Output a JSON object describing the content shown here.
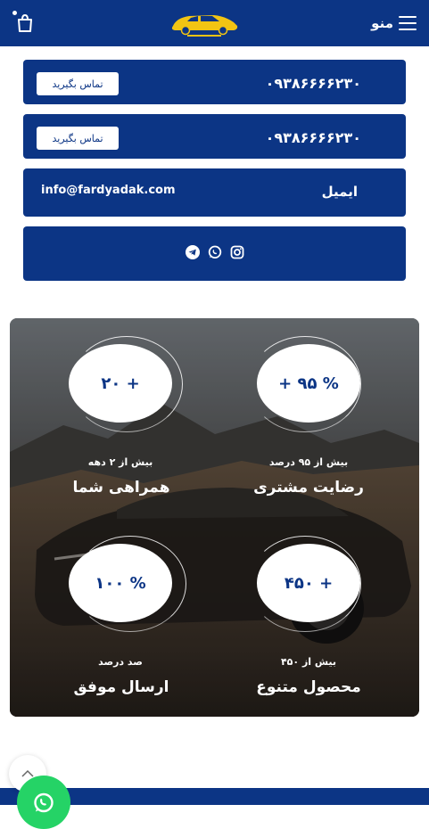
{
  "header": {
    "menu_label": "منو",
    "logo_icon": "car-logo-icon",
    "cart_icon": "shopping-bag-icon"
  },
  "contacts": [
    {
      "phone": "۰۹۳۸۶۶۶۶۲۳۰",
      "button_label": "تماس بگیرید"
    },
    {
      "phone": "۰۹۳۸۶۶۶۶۲۳۰",
      "button_label": "تماس بگیرید"
    }
  ],
  "email": {
    "label": "ایمیل",
    "value": "info@fardyadak.com"
  },
  "social": [
    "instagram-icon",
    "whatsapp-icon",
    "telegram-icon"
  ],
  "stats": [
    {
      "value": "% ۹۵ +",
      "sub": "بیش از ۹۵ درصد",
      "title": "رضایت مشتری"
    },
    {
      "value": "+ ۲۰",
      "sub": "بیش از ۲ دهه",
      "title": "همراهی شما"
    },
    {
      "value": "+ ۴۵۰",
      "sub": "بیش از ۴۵۰",
      "title": "محصول متنوع"
    },
    {
      "value": "% ۱۰۰",
      "sub": "صد درصد",
      "title": "ارسال موفق"
    }
  ],
  "colors": {
    "brand": "#0c3585",
    "whatsapp": "#25d366"
  }
}
